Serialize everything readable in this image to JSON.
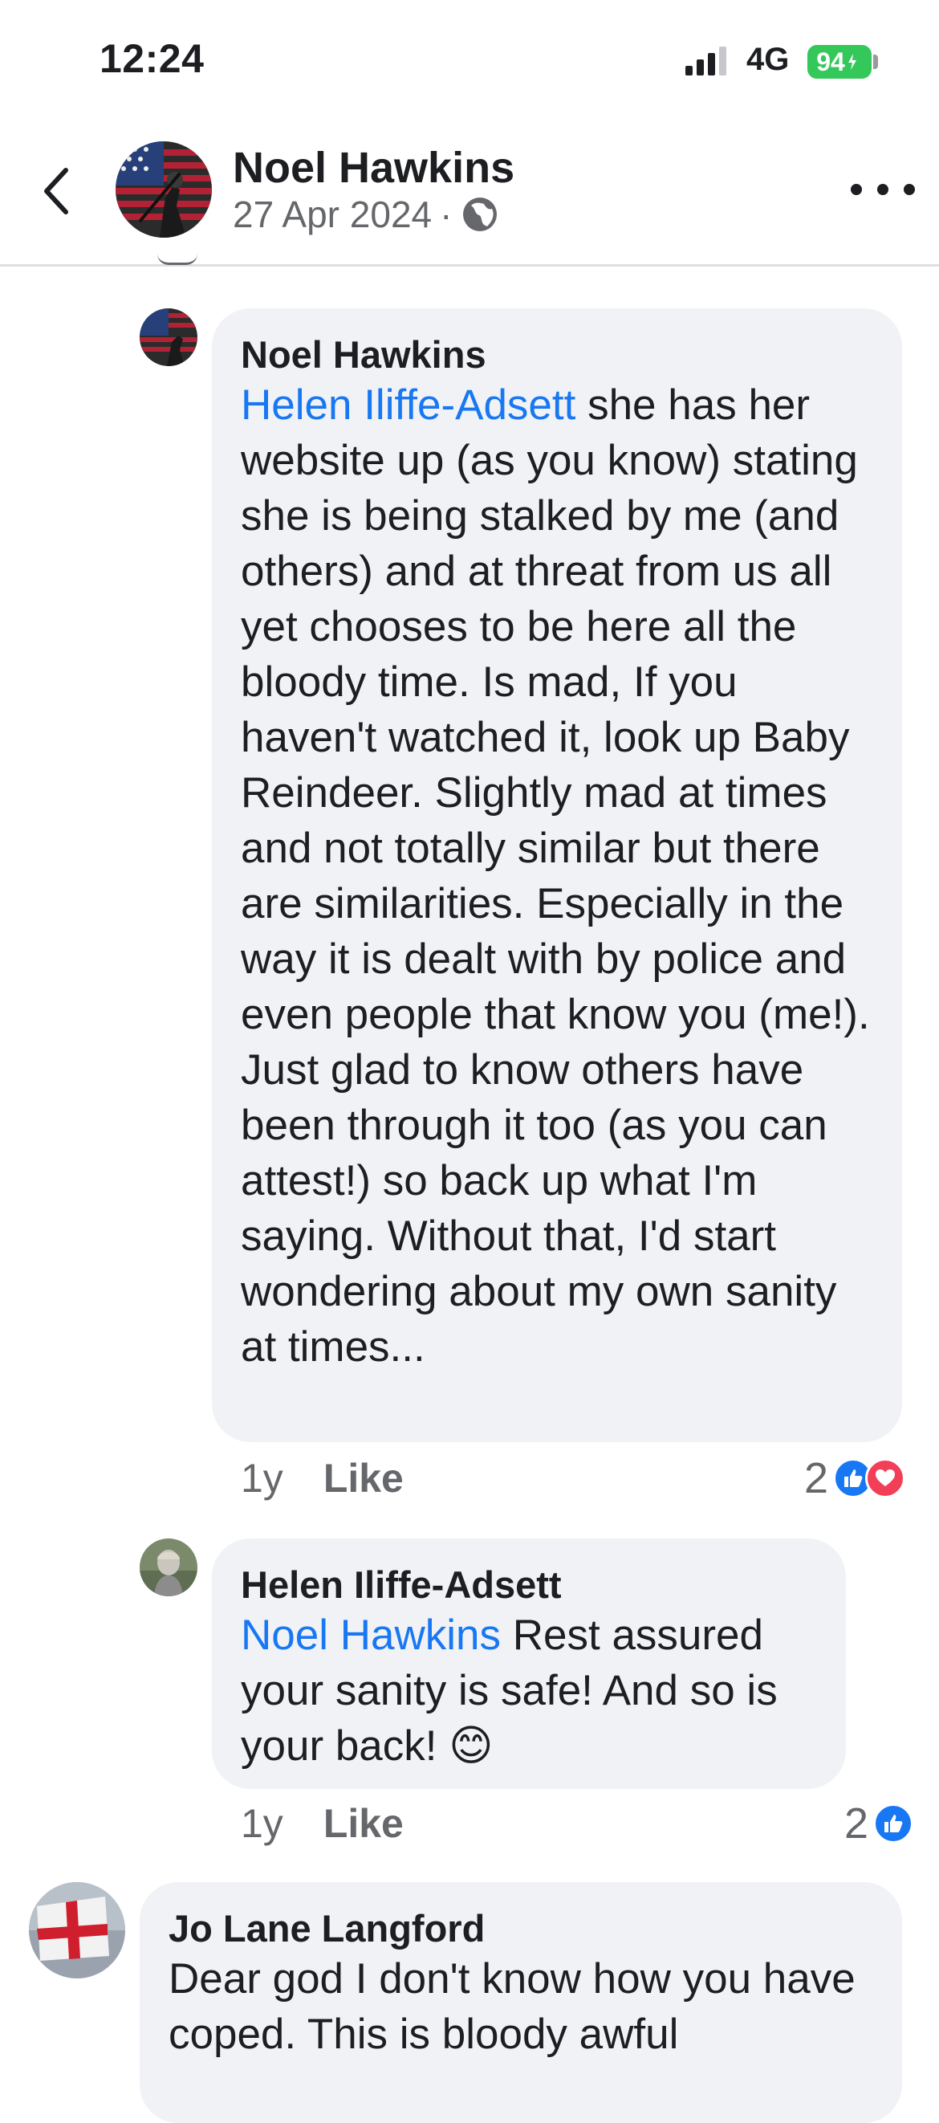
{
  "status_bar": {
    "time": "12:24",
    "network": "4G",
    "battery": "94"
  },
  "header": {
    "name": "Noel Hawkins",
    "date": "27 Apr 2024",
    "separator": "·"
  },
  "comments": [
    {
      "author": "Noel Hawkins",
      "mention": "Helen Iliffe-Adsett",
      "text": " she has her website up (as you know) stating she is being stalked by me (and others) and at threat from us all yet chooses to be here all the bloody time. Is mad, If you haven't watched it, look up Baby Reindeer. Slightly mad at times and not totally similar but there are similarities. Especially in the way it is dealt with by police and even people that know you (me!). Just glad to know others have been through it too (as you can attest!) so back up what I'm saying. Without that, I'd start wondering about my own sanity at times...",
      "age": "1y",
      "like_label": "Like",
      "reaction_count": "2",
      "reactions": [
        "like-icon",
        "love-icon"
      ]
    },
    {
      "author": "Helen Iliffe-Adsett",
      "mention": "Noel Hawkins",
      "text": " Rest assured your sanity is safe! And so is your back!  😊",
      "age": "1y",
      "like_label": "Like",
      "reaction_count": "2",
      "reactions": [
        "like-icon"
      ]
    },
    {
      "author": "Jo Lane Langford",
      "text": "Dear god I don't know how you have coped. This is bloody awful"
    }
  ],
  "colors": {
    "mention": "#1877f2",
    "bubble": "#f0f2f5",
    "battery": "#34c759",
    "love": "#f33e58"
  }
}
